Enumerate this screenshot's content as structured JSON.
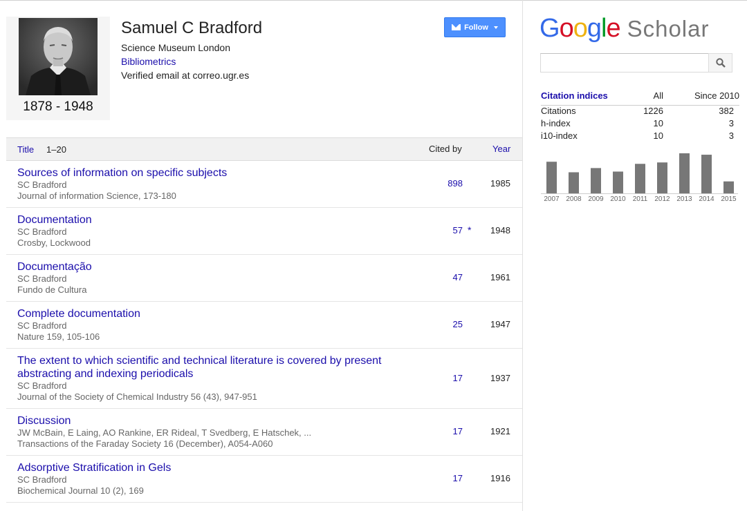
{
  "profile": {
    "name": "Samuel C Bradford",
    "affiliation": "Science Museum London",
    "interest": "Bibliometrics",
    "email": "Verified email at correo.ugr.es",
    "lifespan": "1878 - 1948",
    "follow_label": "Follow"
  },
  "table": {
    "header_title": "Title",
    "header_range": "1–20",
    "header_cited": "Cited by",
    "header_year": "Year",
    "rows": [
      {
        "title": "Sources of information on specific subjects",
        "authors": "SC Bradford",
        "venue": "Journal of information Science, 173-180",
        "cited": "898",
        "year": "1985",
        "star": ""
      },
      {
        "title": "Documentation",
        "authors": "SC Bradford",
        "venue": "Crosby, Lockwood",
        "cited": "57",
        "year": "1948",
        "star": "*"
      },
      {
        "title": "Documentação",
        "authors": "SC Bradford",
        "venue": "Fundo de Cultura",
        "cited": "47",
        "year": "1961",
        "star": ""
      },
      {
        "title": "Complete documentation",
        "authors": "SC Bradford",
        "venue": "Nature 159, 105-106",
        "cited": "25",
        "year": "1947",
        "star": ""
      },
      {
        "title": "The extent to which scientific and technical literature is covered by present abstracting and indexing periodicals",
        "authors": "SC Bradford",
        "venue": "Journal of the Society of Chemical Industry 56 (43), 947-951",
        "cited": "17",
        "year": "1937",
        "star": ""
      },
      {
        "title": "Discussion",
        "authors": "JW McBain, E Laing, AO Rankine, ER Rideal, T Svedberg, E Hatschek, ...",
        "venue": "Transactions of the Faraday Society 16 (December), A054-A060",
        "cited": "17",
        "year": "1921",
        "star": ""
      },
      {
        "title": "Adsorptive Stratification in Gels",
        "authors": "SC Bradford",
        "venue": "Biochemical Journal 10 (2), 169",
        "cited": "17",
        "year": "1916",
        "star": ""
      }
    ]
  },
  "scholar": {
    "logo_google": [
      "G",
      "o",
      "o",
      "g",
      "l",
      "e"
    ],
    "logo_scholar": "Scholar",
    "search_value": "",
    "search_icon": "magnifier-icon"
  },
  "citation_indices": {
    "title": "Citation indices",
    "col_all": "All",
    "col_since": "Since 2010",
    "rows": [
      {
        "label": "Citations",
        "all": "1226",
        "since": "382"
      },
      {
        "label": "h-index",
        "all": "10",
        "since": "3"
      },
      {
        "label": "i10-index",
        "all": "10",
        "since": "3"
      }
    ]
  },
  "chart_data": {
    "type": "bar",
    "categories": [
      "2007",
      "2008",
      "2009",
      "2010",
      "2011",
      "2012",
      "2013",
      "2014",
      "2015"
    ],
    "values": [
      45,
      30,
      36,
      31,
      42,
      44,
      57,
      55,
      17
    ],
    "title": "",
    "xlabel": "",
    "ylabel": "",
    "bar_color": "#777777"
  },
  "colors": {
    "link": "#1a0dab",
    "follow_button": "#4d90fe",
    "header_bg": "#f1f1f1"
  }
}
